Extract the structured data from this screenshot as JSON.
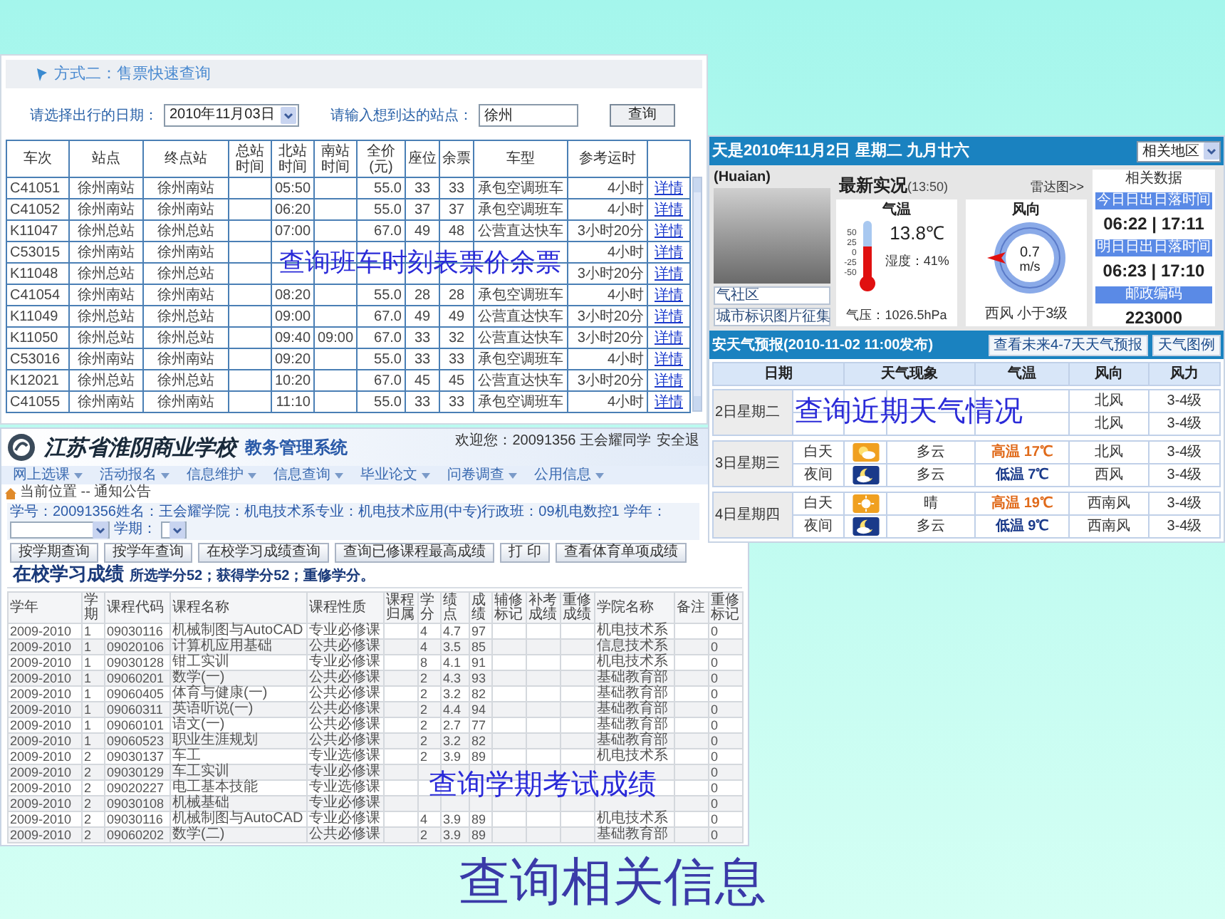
{
  "bus_panel": {
    "title": "方式二：售票快速查询",
    "date_label": "请选择出行的日期：",
    "date_value": "2010年11月03日",
    "station_label": "请输入想到达的站点：",
    "station_value": "徐州",
    "search_button": "查询",
    "columns": [
      "车次",
      "站点",
      "终点站",
      "总站时间",
      "北站时间",
      "南站时间",
      "全价(元)",
      "座位",
      "余票",
      "车型",
      "参考运时"
    ],
    "rows": [
      [
        "C41051",
        "徐州南站",
        "徐州南站",
        null,
        "05:50",
        null,
        "55.0",
        "33",
        "33",
        "承包空调班车",
        "4小时",
        "详情"
      ],
      [
        "C41052",
        "徐州南站",
        "徐州南站",
        null,
        "06:20",
        null,
        "55.0",
        "37",
        "37",
        "承包空调班车",
        "4小时",
        "详情"
      ],
      [
        "K11047",
        "徐州总站",
        "徐州总站",
        null,
        "07:00",
        null,
        "67.0",
        "49",
        "48",
        "公营直达快车",
        "3小时20分",
        "详情"
      ],
      [
        "C53015",
        "徐州南站",
        "徐州南站",
        null,
        null,
        null,
        null,
        null,
        null,
        null,
        "4小时",
        "详情"
      ],
      [
        "K11048",
        "徐州总站",
        "徐州总站",
        null,
        null,
        null,
        null,
        null,
        null,
        null,
        "3小时20分",
        "详情"
      ],
      [
        "C41054",
        "徐州南站",
        "徐州南站",
        null,
        "08:20",
        null,
        "55.0",
        "28",
        "28",
        "承包空调班车",
        "4小时",
        "详情"
      ],
      [
        "K11049",
        "徐州总站",
        "徐州总站",
        null,
        "09:00",
        null,
        "67.0",
        "49",
        "49",
        "公营直达快车",
        "3小时20分",
        "详情"
      ],
      [
        "K11050",
        "徐州总站",
        "徐州总站",
        null,
        "09:40",
        "09:00",
        "67.0",
        "33",
        "32",
        "公营直达快车",
        "3小时20分",
        "详情"
      ],
      [
        "C53016",
        "徐州南站",
        "徐州南站",
        null,
        "09:20",
        null,
        "55.0",
        "33",
        "33",
        "承包空调班车",
        "4小时",
        "详情"
      ],
      [
        "K12021",
        "徐州总站",
        "徐州总站",
        null,
        "10:20",
        null,
        "67.0",
        "45",
        "45",
        "公营直达快车",
        "3小时20分",
        "详情"
      ],
      [
        "C41055",
        "徐州南站",
        "徐州南站",
        null,
        "11:10",
        null,
        "55.0",
        "33",
        "33",
        "承包空调班车",
        "4小时",
        "详情"
      ]
    ],
    "caption": "查询班车时刻表票价余票"
  },
  "weather": {
    "header": "天是2010年11月2日 星期二 九月廿六",
    "region_select": "相关地区",
    "city_label": "(Huaian)",
    "photo_buttons": [
      "气社区",
      "城市标识图片征集"
    ],
    "now": {
      "title": "最新实况",
      "time": "(13:50)",
      "radar_link": "雷达图>>",
      "temp_title": "气温",
      "temp": "13.8℃",
      "scale": [
        "50",
        "25",
        "0",
        "-25",
        "-50"
      ],
      "humidity": "湿度：41%",
      "pressure": "气压：1026.5hPa",
      "wind_title": "风向",
      "wind_speed": "0.7",
      "wind_unit": "m/s",
      "wind_desc": "西风 小于3级"
    },
    "related": {
      "title": "相关数据",
      "items": [
        {
          "label": "今日日出日落时间",
          "value": "06:22 | 17:11"
        },
        {
          "label": "明日日出日落时间",
          "value": "06:23 | 17:10"
        },
        {
          "label": "邮政编码",
          "value": "223000"
        }
      ]
    },
    "forecast": {
      "title": "安天气预报(2010-11-02 11:00发布)",
      "buttons": [
        "查看未来4-7天天气预报",
        "天气图例"
      ],
      "columns": [
        "日期",
        "天气现象",
        "气温",
        "风向",
        "风力"
      ],
      "days": [
        {
          "date": "2日星期二",
          "periods": [
            {
              "wind_dir": "北风",
              "wind_force": "3-4级"
            },
            {
              "wind_dir": "北风",
              "wind_force": "3-4级"
            }
          ]
        },
        {
          "date": "3日星期三",
          "periods": [
            {
              "label": "白天",
              "kind": "partly_cloudy",
              "weather": "多云",
              "temp": "高温 17℃",
              "wind_dir": "北风",
              "wind_force": "3-4级"
            },
            {
              "label": "夜间",
              "kind": "night_cloudy",
              "weather": "多云",
              "temp": "低温 7℃",
              "wind_dir": "西风",
              "wind_force": "3-4级"
            }
          ]
        },
        {
          "date": "4日星期四",
          "periods": [
            {
              "label": "白天",
              "kind": "sunny",
              "weather": "晴",
              "temp": "高温 19℃",
              "wind_dir": "西南风",
              "wind_force": "3-4级"
            },
            {
              "label": "夜间",
              "kind": "night_cloudy",
              "weather": "多云",
              "temp": "低温 9℃",
              "wind_dir": "西南风",
              "wind_force": "3-4级"
            }
          ]
        }
      ]
    },
    "caption": "查询近期天气情况"
  },
  "grades": {
    "logo_text": "江苏省淮阴商业学校",
    "system_name": "教务管理系统",
    "welcome": "欢迎您：20091356 王会耀同学",
    "logout_link": "安全退",
    "menu": [
      "网上选课",
      "活动报名",
      "信息维护",
      "信息查询",
      "毕业论文",
      "问卷调查",
      "公用信息"
    ],
    "location": "当前位置 -- 通知公告",
    "student_info": "学号：20091356姓名：王会耀学院：机电技术系专业：机电技术应用(中专)行政班：09机电数控1",
    "year_label": "学年：",
    "term_label": "学期：",
    "buttons": [
      "按学期查询",
      "按学年查询",
      "在校学习成绩查询",
      "查询已修课程最高成绩",
      "打 印",
      "查看体育单项成绩"
    ],
    "heading": "在校学习成绩",
    "summary": "所选学分52；获得学分52；重修学分。",
    "columns": [
      "学年",
      "学期",
      "课程代码",
      "课程名称",
      "课程性质",
      "课程归属",
      "学分",
      "绩点",
      "成绩",
      "辅修标记",
      "补考成绩",
      "重修成绩",
      "学院名称",
      "备注",
      "重修标记"
    ],
    "rows": [
      [
        "2009-2010",
        "1",
        "09030116",
        "机械制图与AutoCAD",
        "专业必修课",
        null,
        "4",
        "4.7",
        "97",
        null,
        null,
        null,
        "机电技术系",
        null,
        "0"
      ],
      [
        "2009-2010",
        "1",
        "09020106",
        "计算机应用基础",
        "公共必修课",
        null,
        "4",
        "3.5",
        "85",
        null,
        null,
        null,
        "信息技术系",
        null,
        "0"
      ],
      [
        "2009-2010",
        "1",
        "09030128",
        "钳工实训",
        "专业必修课",
        null,
        "8",
        "4.1",
        "91",
        null,
        null,
        null,
        "机电技术系",
        null,
        "0"
      ],
      [
        "2009-2010",
        "1",
        "09060201",
        "数学(一)",
        "公共必修课",
        null,
        "2",
        "4.3",
        "93",
        null,
        null,
        null,
        "基础教育部",
        null,
        "0"
      ],
      [
        "2009-2010",
        "1",
        "09060405",
        "体育与健康(一)",
        "公共必修课",
        null,
        "2",
        "3.2",
        "82",
        null,
        null,
        null,
        "基础教育部",
        null,
        "0"
      ],
      [
        "2009-2010",
        "1",
        "09060311",
        "英语听说(一)",
        "公共必修课",
        null,
        "2",
        "4.4",
        "94",
        null,
        null,
        null,
        "基础教育部",
        null,
        "0"
      ],
      [
        "2009-2010",
        "1",
        "09060101",
        "语文(一)",
        "公共必修课",
        null,
        "2",
        "2.7",
        "77",
        null,
        null,
        null,
        "基础教育部",
        null,
        "0"
      ],
      [
        "2009-2010",
        "1",
        "09060523",
        "职业生涯规划",
        "公共必修课",
        null,
        "2",
        "3.2",
        "82",
        null,
        null,
        null,
        "基础教育部",
        null,
        "0"
      ],
      [
        "2009-2010",
        "2",
        "09030137",
        "车工",
        "专业选修课",
        null,
        "2",
        "3.9",
        "89",
        null,
        null,
        null,
        "机电技术系",
        null,
        "0"
      ],
      [
        "2009-2010",
        "2",
        "09030129",
        "车工实训",
        "专业必修课",
        null,
        null,
        null,
        null,
        null,
        null,
        null,
        null,
        null,
        "0"
      ],
      [
        "2009-2010",
        "2",
        "09020227",
        "电工基本技能",
        "专业选修课",
        null,
        null,
        null,
        null,
        null,
        null,
        null,
        null,
        null,
        "0"
      ],
      [
        "2009-2010",
        "2",
        "09030108",
        "机械基础",
        "专业必修课",
        null,
        null,
        null,
        null,
        null,
        null,
        null,
        null,
        null,
        "0"
      ],
      [
        "2009-2010",
        "2",
        "09030116",
        "机械制图与AutoCAD",
        "专业必修课",
        null,
        "4",
        "3.9",
        "89",
        null,
        null,
        null,
        "机电技术系",
        null,
        "0"
      ],
      [
        "2009-2010",
        "2",
        "09060202",
        "数学(二)",
        "公共必修课",
        null,
        "2",
        "3.9",
        "89",
        null,
        null,
        null,
        "基础教育部",
        null,
        "0"
      ]
    ],
    "caption": "查询学期考试成绩"
  },
  "slide_title": "查询相关信息"
}
